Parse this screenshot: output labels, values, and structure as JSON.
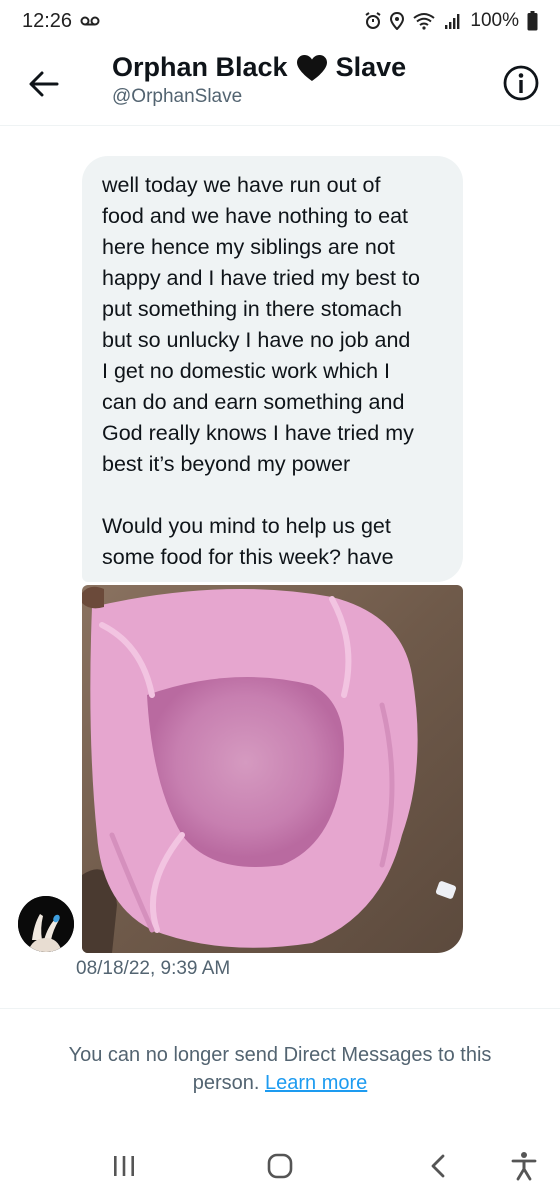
{
  "status_bar": {
    "time": "12:26",
    "battery": "100%",
    "icons": [
      "voicemail-icon",
      "alarm-icon",
      "location-icon",
      "wifi-icon",
      "signal-icon",
      "battery-icon"
    ]
  },
  "header": {
    "name_part1": "Orphan Black",
    "name_part2": "Slave",
    "handle": "@OrphanSlave",
    "back_icon": "arrow-left-icon",
    "info_icon": "info-icon"
  },
  "message": {
    "paragraph1": "well today we have run out of\nfood and we have nothing to eat\nhere hence my siblings are not\nhappy and I have tried my best to\nput something in there stomach\nbut so unlucky I have no job and\nI get no domestic work which I\ncan do and earn something and\nGod really knows I have tried my\nbest it’s beyond my power",
    "paragraph2": "Would you mind to help us get\nsome food for this week? have",
    "timestamp": "08/18/22, 9:39 AM"
  },
  "notice": {
    "text": "You can no longer send Direct Messages to this",
    "text2": "person.",
    "link": "Learn more"
  },
  "nav": {
    "icons": [
      "recent-apps-icon",
      "home-icon",
      "back-icon",
      "accessibility-icon"
    ]
  },
  "colors": {
    "bubble_bg": "#eff3f4",
    "link": "#1d9bf0",
    "secondary_text": "#536471",
    "primary_text": "#0f1419"
  }
}
